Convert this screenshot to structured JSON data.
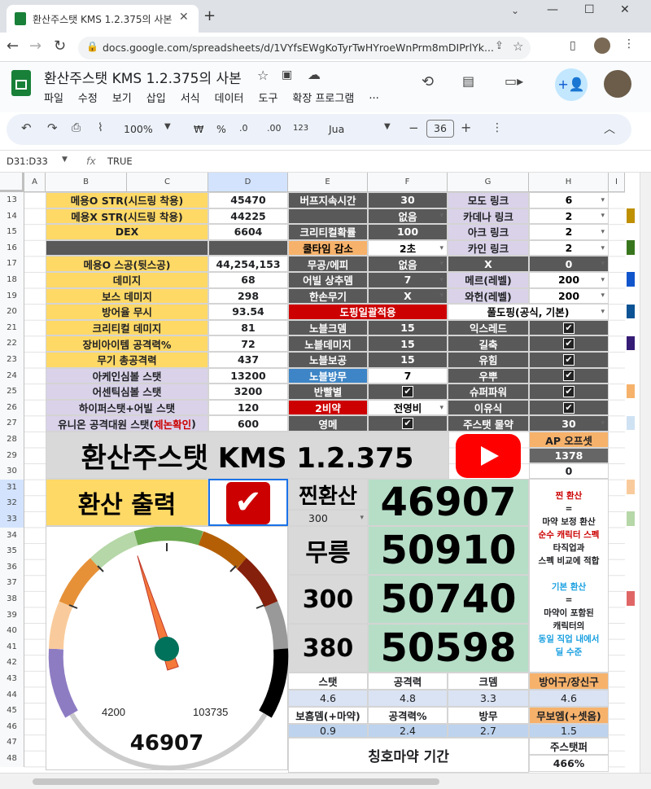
{
  "browser": {
    "tab_title": "환산주스탯 KMS 1.2.375의 사본",
    "url": "docs.google.com/spreadsheets/d/1VYfsEWgKoTyrTwHYroeWnPrm8mDIPrlYk..."
  },
  "doc": {
    "title": "환산주스탯 KMS 1.2.375의 사본",
    "menu": [
      "파일",
      "수정",
      "보기",
      "삽입",
      "서식",
      "데이터",
      "도구",
      "확장 프로그램",
      "..."
    ]
  },
  "toolbar": {
    "zoom": "100%",
    "currency": "₩",
    "percent": "%",
    "dec_down": ".0",
    "dec_up": ".00",
    "format123": "123",
    "font": "Jua",
    "font_size": "36"
  },
  "formula": {
    "namebox": "D31:D33",
    "fx": "fx",
    "value": "TRUE"
  },
  "columns": [
    "A",
    "B",
    "C",
    "D",
    "E",
    "F",
    "G",
    "H",
    "I"
  ],
  "rows": [
    "13",
    "14",
    "15",
    "16",
    "17",
    "18",
    "19",
    "20",
    "21",
    "22",
    "23",
    "24",
    "25",
    "26",
    "27",
    "28",
    "29",
    "30",
    "31",
    "32",
    "33",
    "34",
    "35",
    "36",
    "37",
    "38",
    "39",
    "40",
    "41",
    "42",
    "43",
    "44",
    "45",
    "46",
    "47",
    "48"
  ],
  "left": [
    {
      "label": "메용O STR(시드링 착용)",
      "value": "45470"
    },
    {
      "label": "메용X STR(시드링 착용)",
      "value": "44225"
    },
    {
      "label": "DEX",
      "value": "6604"
    },
    {
      "label": "",
      "value": ""
    },
    {
      "label": "메용O 스공(뒷스공)",
      "value": "44,254,153"
    },
    {
      "label": "데미지",
      "value": "68"
    },
    {
      "label": "보스 데미지",
      "value": "298"
    },
    {
      "label": "방어율 무시",
      "value": "93.54"
    },
    {
      "label": "크리티컬 데미지",
      "value": "81"
    },
    {
      "label": "장비아이템 공격력%",
      "value": "72"
    },
    {
      "label": "무기 총공격력",
      "value": "437"
    },
    {
      "label": "아케인심볼 스탯",
      "value": "13200"
    },
    {
      "label": "어센틱심볼 스탯",
      "value": "3200"
    },
    {
      "label": "하이퍼스탯+어빌 스탯",
      "value": "120"
    },
    {
      "label": "유니온 공격대원 스탯(",
      "label_red": "제논확인",
      "label_end": ")",
      "value": "600"
    }
  ],
  "mid": [
    {
      "label": "버프지속시간",
      "value": "30"
    },
    {
      "label": "",
      "value": "없음"
    },
    {
      "label": "크리티컬확률",
      "value": "100"
    },
    {
      "label": "쿨타임 감소",
      "value": "2초"
    },
    {
      "label": "무공/에피",
      "value": "없음"
    },
    {
      "label": "어빌 상추뎀",
      "value": "7"
    },
    {
      "label": "한손무기",
      "value": "X"
    },
    {
      "label": "도핑일괄적용",
      "value": ""
    },
    {
      "label": "노블크뎀",
      "value": "15"
    },
    {
      "label": "노블데미지",
      "value": "15"
    },
    {
      "label": "노블보공",
      "value": "15"
    },
    {
      "label": "노블방무",
      "value": "7"
    },
    {
      "label": "반빨별",
      "value": "✔"
    },
    {
      "label": "2비약",
      "value": "전영비"
    },
    {
      "label": "영메",
      "value": "✔"
    }
  ],
  "right": [
    {
      "label": "모도 링크",
      "value": "6"
    },
    {
      "label": "카데나 링크",
      "value": "2"
    },
    {
      "label": "아크 링크",
      "value": "2"
    },
    {
      "label": "카인 링크",
      "value": "2"
    },
    {
      "label": "X",
      "value": "0"
    },
    {
      "label": "메르(레벨)",
      "value": "200"
    },
    {
      "label": "와헌(레벨)",
      "value": "200"
    },
    {
      "label": "풀도핑(공식, 기본)",
      "value": ""
    },
    {
      "label": "익스레드",
      "value": "✔"
    },
    {
      "label": "길축",
      "value": "✔"
    },
    {
      "label": "유힘",
      "value": "✔"
    },
    {
      "label": "우뿌",
      "value": "✔"
    },
    {
      "label": "슈퍼파워",
      "value": "✔"
    },
    {
      "label": "이유식",
      "value": "✔"
    },
    {
      "label": "주스탯 물약",
      "value": "30"
    }
  ],
  "banner": {
    "title": "환산주스탯 KMS 1.2.375",
    "ap_label": "AP 오프셋",
    "ap_value": "1378",
    "ap_zero": "0"
  },
  "output": {
    "label": "환산 출력",
    "check": "✔",
    "zzin_label": "찐환산",
    "zzin_level": "300",
    "zzin_value": "46907",
    "rows": [
      {
        "label": "무릉",
        "value": "50910"
      },
      {
        "label": "300",
        "value": "50740"
      },
      {
        "label": "380",
        "value": "50598"
      }
    ]
  },
  "notes": {
    "t1": "찐 환산",
    "eq1": "=",
    "l1": "마약 보정 환산",
    "l2": "순수 캐릭터 스펙",
    "l3": "타직업과",
    "l4": "스펙 비교에 적합",
    "t2": "기본 환산",
    "eq2": "=",
    "l5": "마약이 포함된",
    "l6": "캐릭터의",
    "l7": "동일 직업 내에서",
    "l8": "딜 수준"
  },
  "gauge": {
    "min": "4200",
    "max": "103735",
    "value": "46907",
    "fraction": 0.43
  },
  "stats": {
    "h1": [
      "스탯",
      "공격력",
      "크뎀",
      "방어구/장신구"
    ],
    "v1": [
      "4.6",
      "4.8",
      "3.3",
      "4.6"
    ],
    "h2": [
      "보흠뎀(+마약)",
      "공격력%",
      "방무",
      "무보엠(+셋옴)"
    ],
    "v2": [
      "0.9",
      "2.4",
      "2.7",
      "1.5"
    ],
    "bottom": "칭호마약 기간",
    "jusu_label": "주스탯퍼",
    "jusu_value": "466%"
  },
  "colors": {
    "accent": "#cc0000",
    "yellow": "#ffd966",
    "mint": "#b6dec7",
    "gray": "#595959"
  }
}
